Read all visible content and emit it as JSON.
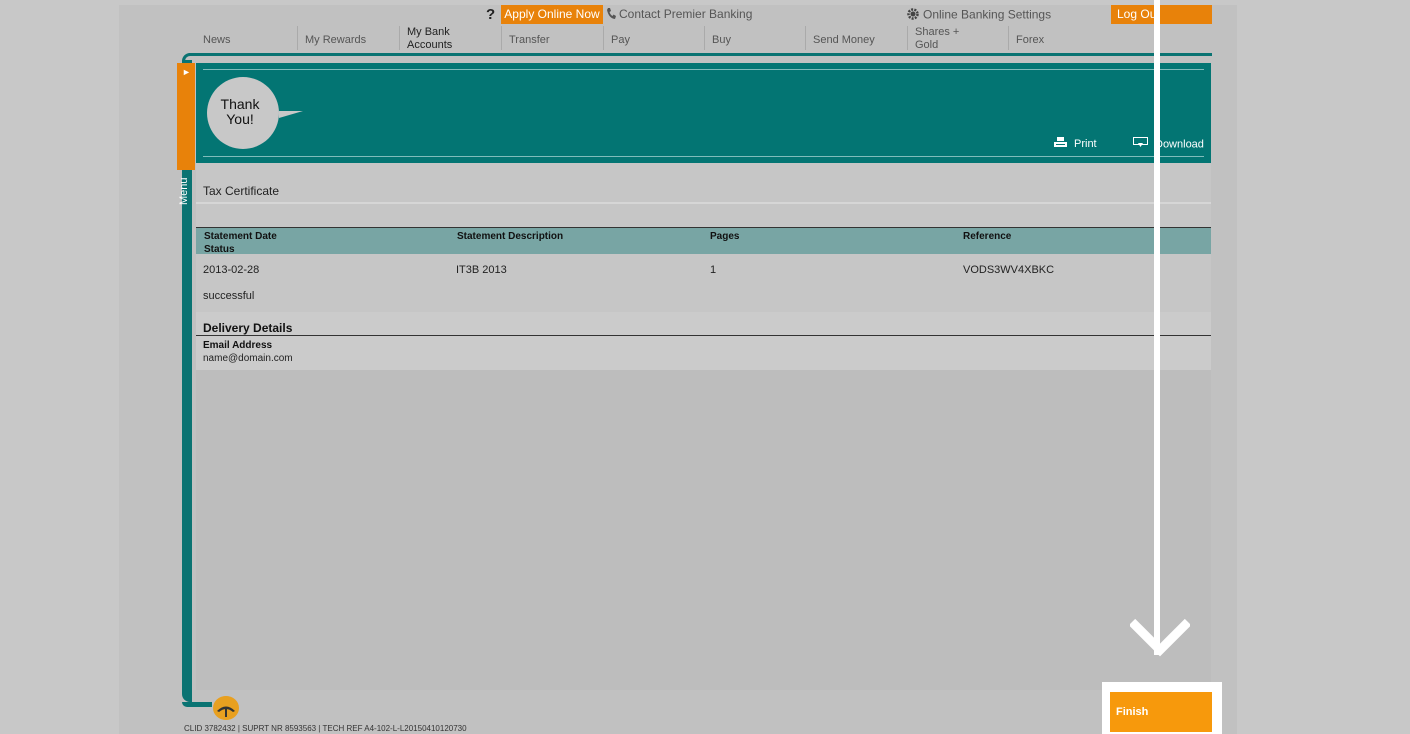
{
  "topbar": {
    "help": "?",
    "apply_now": "Apply Online Now",
    "contact": "Contact Premier Banking",
    "settings": "Online Banking Settings",
    "logout": "Log Out"
  },
  "nav": [
    {
      "label": "News"
    },
    {
      "label": "My Rewards"
    },
    {
      "label": "My Bank\nAccounts"
    },
    {
      "label": "Transfer"
    },
    {
      "label": "Pay"
    },
    {
      "label": "Buy"
    },
    {
      "label": "Send Money"
    },
    {
      "label": "Shares +\nGold"
    },
    {
      "label": "Forex"
    }
  ],
  "menu_label": "Menu",
  "header": {
    "bubble": "Thank\nYou!",
    "print": "Print",
    "download": "Download"
  },
  "section_title": "Tax Certificate",
  "table": {
    "headers": [
      "Statement Date",
      "Statement Description",
      "Pages",
      "Reference",
      "Status"
    ],
    "row": {
      "date": "2013-02-28",
      "description": "IT3B 2013",
      "pages": "1",
      "reference": "VODS3WV4XBKC",
      "status": "successful"
    }
  },
  "delivery": {
    "title": "Delivery Details",
    "email_label": "Email Address",
    "email_value": "name@domain.com"
  },
  "finish": "Finish",
  "footer": "CLID 3782432 | SUPRT NR 8593563 | TECH REF A4-102-L-L20150410120730",
  "colors": {
    "teal": "#037573",
    "orange": "#e8820a",
    "table_header": "#78a5a4"
  }
}
